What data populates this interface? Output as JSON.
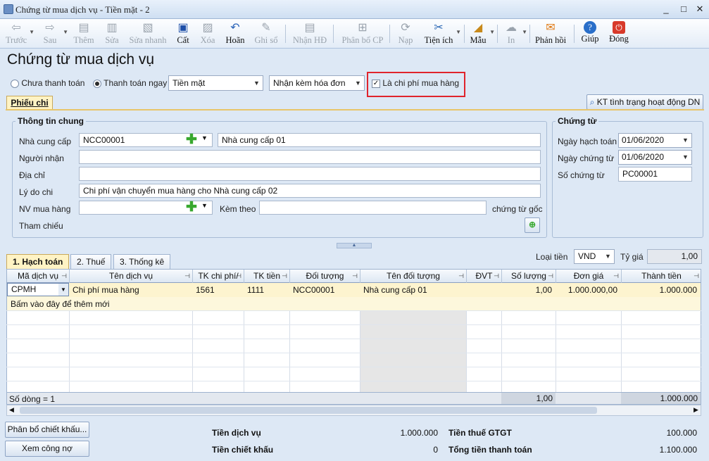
{
  "window": {
    "title": "Chứng từ mua dịch vụ - Tiền mặt - 2",
    "min": "_",
    "max": "□",
    "close": "✕"
  },
  "toolbar": {
    "truoc": "Trước",
    "sau": "Sau",
    "them": "Thêm",
    "sua": "Sửa",
    "sua_nhanh": "Sửa nhanh",
    "cat": "Cất",
    "xoa": "Xóa",
    "hoan": "Hoãn",
    "ghi_so": "Ghi sổ",
    "nhan_hd": "Nhận HĐ",
    "phan_bo_cp": "Phân bổ CP",
    "nap": "Nạp",
    "tien_ich": "Tiện ích",
    "mau": "Mẫu",
    "in": "In",
    "phan_hoi": "Phản hồi",
    "giup": "Giúp",
    "dong": "Đóng"
  },
  "page_title": "Chứng từ mua dịch vụ",
  "payment": {
    "chua_thanh_toan": "Chưa thanh toán",
    "thanh_toan_ngay": "Thanh toán ngay",
    "method": "Tiền mặt",
    "invoice": "Nhận kèm hóa đơn",
    "la_chi_phi": "Là chi phí mua hàng",
    "la_chi_phi_checked": true
  },
  "tabs_top": {
    "phieu_chi": "Phiếu chi",
    "kt_button": "KT tình trạng hoạt động DN"
  },
  "info": {
    "title": "Thông tin chung",
    "nha_cung_cap_label": "Nhà cung cấp",
    "nha_cung_cap_code": "NCC00001",
    "nha_cung_cap_name": "Nhà cung cấp 01",
    "nguoi_nhan_label": "Người nhận",
    "nguoi_nhan": "",
    "dia_chi_label": "Địa chỉ",
    "dia_chi": "",
    "ly_do_label": "Lý do chi",
    "ly_do": "Chi phí vận chuyển mua hàng cho Nhà cung cấp 02",
    "nv_label": "NV mua hàng",
    "nv": "",
    "kem_theo_label": "Kèm theo",
    "kem_theo": "",
    "chung_tu_goc": "chứng từ gốc",
    "tham_chieu_label": "Tham chiếu"
  },
  "voucher": {
    "title": "Chứng từ",
    "ngay_hach_toan_label": "Ngày hạch toán",
    "ngay_hach_toan": "01/06/2020",
    "ngay_chung_tu_label": "Ngày chứng từ",
    "ngay_chung_tu": "01/06/2020",
    "so_chung_tu_label": "Số chứng từ",
    "so_chung_tu": "PC00001"
  },
  "detail_tabs": {
    "hach_toan": "1. Hạch toán",
    "thue": "2. Thuế",
    "thong_ke": "3. Thống kê",
    "loai_tien_label": "Loại tiền",
    "loai_tien": "VND",
    "ty_gia_label": "Tỷ giá",
    "ty_gia": "1,00"
  },
  "grid": {
    "headers": [
      "Mã dịch vụ",
      "Tên dịch vụ",
      "TK chi phí/",
      "TK tiền",
      "Đối tượng",
      "Tên đối tượng",
      "ĐVT",
      "Số lượng",
      "Đơn giá",
      "Thành tiền"
    ],
    "row": {
      "ma": "CPMH",
      "ten": "Chi phí mua hàng",
      "tk_cp": "1561",
      "tk_tien": "1111",
      "doi_tuong": "NCC00001",
      "ten_doi_tuong": "Nhà cung cấp 01",
      "dvt": "",
      "so_luong": "1,00",
      "don_gia": "1.000.000,00",
      "thanh_tien": "1.000.000"
    },
    "new_row_hint": "Bấm vào đây để thêm mới",
    "footer": {
      "so_dong": "Số dòng = 1",
      "so_luong": "1,00",
      "thanh_tien": "1.000.000"
    }
  },
  "bottom": {
    "phan_bo": "Phân bổ chiết khấu...",
    "xem_cong_no": "Xem công nợ",
    "tien_dich_vu_label": "Tiền dịch vụ",
    "tien_dich_vu": "1.000.000",
    "tien_chiet_khau_label": "Tiền chiết khấu",
    "tien_chiet_khau": "0",
    "tien_thue_label": "Tiền thuế GTGT",
    "tien_thue": "100.000",
    "tong_label": "Tổng tiền thanh toán",
    "tong": "1.100.000"
  },
  "colors": {
    "highlight_box": "#e0242c",
    "row_selected": "#fdf4cf",
    "tab_active": "#fff3c4"
  }
}
